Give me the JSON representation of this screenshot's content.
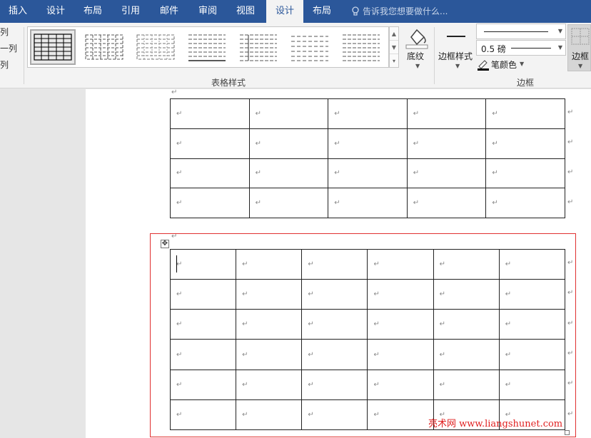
{
  "tabs": [
    {
      "label": "插入",
      "active": false
    },
    {
      "label": "设计",
      "active": false
    },
    {
      "label": "布局",
      "active": false
    },
    {
      "label": "引用",
      "active": false
    },
    {
      "label": "邮件",
      "active": false
    },
    {
      "label": "审阅",
      "active": false
    },
    {
      "label": "视图",
      "active": false
    },
    {
      "label": "设计",
      "active": true
    },
    {
      "label": "布局",
      "active": false
    }
  ],
  "tell_me": "告诉我您想要做什么...",
  "ribbon": {
    "left_fragments": [
      "列",
      "一列",
      "列"
    ],
    "table_styles_label": "表格样式",
    "shading_label": "底纹",
    "border_styles_label": "边框样式",
    "line_weight": "0.5 磅",
    "pen_color_label": "笔颜色",
    "borders_group_label": "边框",
    "borders_button_label": "边框"
  },
  "para_mark": "↵",
  "table1": {
    "rows": 4,
    "cols": 5
  },
  "table2": {
    "rows": 6,
    "cols": 6
  },
  "watermark": "亮术网 www.liangshunet.com",
  "colors": {
    "tabbar": "#2b579a",
    "selection_frame": "#e03030",
    "watermark": "#e02020"
  }
}
